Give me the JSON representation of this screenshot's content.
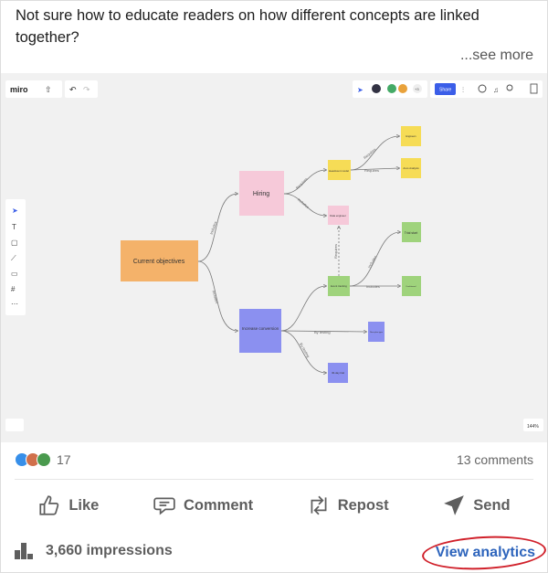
{
  "post": {
    "text": "Not sure how to educate readers on how different concepts are linked together?",
    "see_more": "...see more"
  },
  "miro": {
    "logo": "miro",
    "share_label": "Share",
    "more_users": "+3",
    "zoom_level": "144%",
    "nodes": {
      "objectives": "Current objectives",
      "hiring": "Hiring",
      "conversion": "Increase conversion",
      "headcount": "Headcount model",
      "engineers": "Engineers",
      "asis": "As-is Analysis",
      "data_engineer": "Data engineer",
      "trial_start": "Trial start",
      "event_tracking": "Event tracking",
      "green_right": "Dashboard",
      "new_plan": "New plan type",
      "trial30": "30-day trial"
    },
    "edges": {
      "includes": "Includes",
      "requires": "Requires",
      "by_testing": "By testing"
    },
    "colors": {
      "orange": "#f4b26a",
      "pink": "#f6c9d9",
      "blue": "#8b90f0",
      "yellow": "#f6dc56",
      "green": "#9fd37c",
      "share": "#3b5ee8"
    }
  },
  "social": {
    "reactions_count": "17",
    "comments": "13 comments"
  },
  "actions": {
    "like": "Like",
    "comment": "Comment",
    "repost": "Repost",
    "send": "Send"
  },
  "footer": {
    "impressions": "3,660 impressions",
    "view_analytics": "View analytics"
  }
}
